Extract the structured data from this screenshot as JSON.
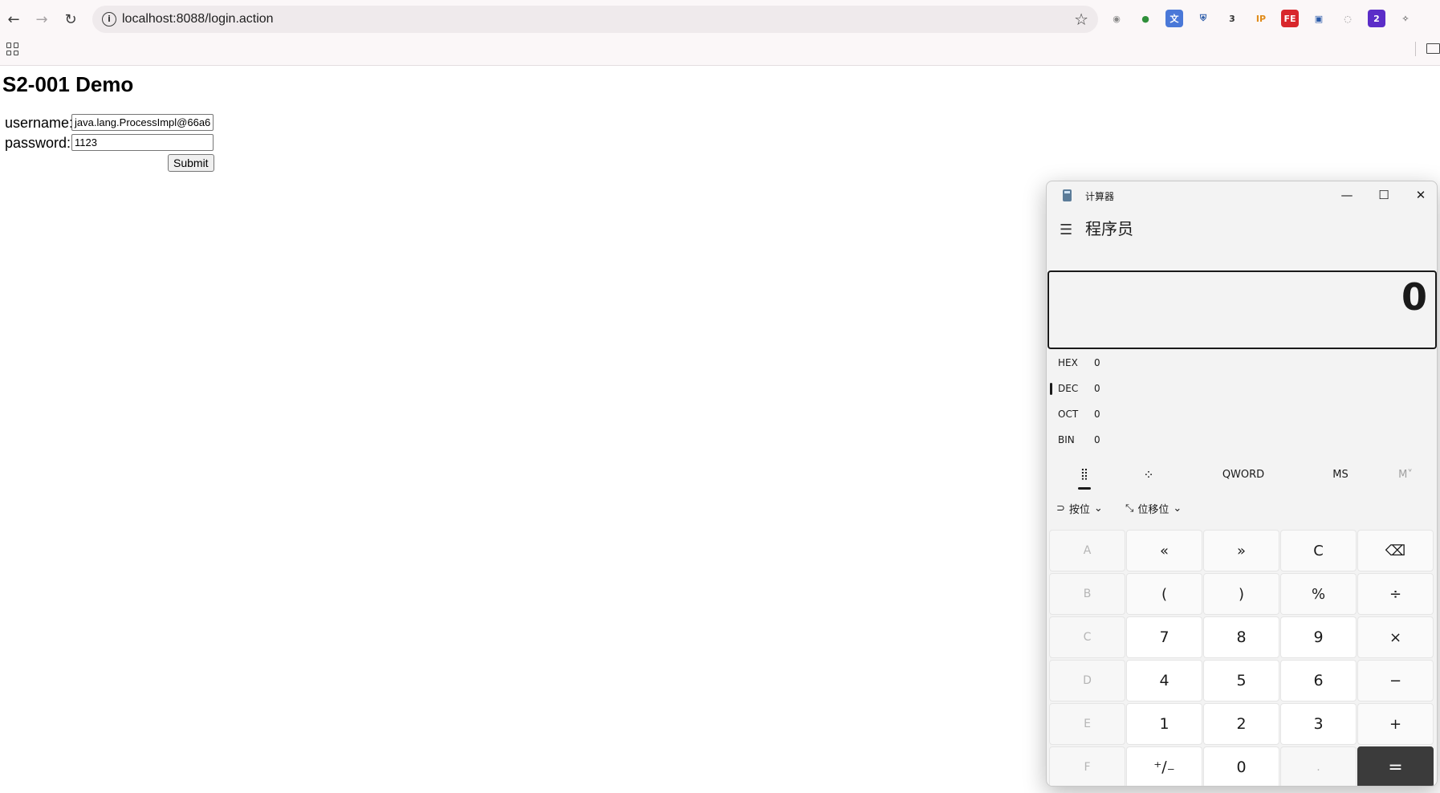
{
  "browser": {
    "url": "localhost:8088/login.action",
    "nav": {
      "back": "←",
      "forward": "→",
      "reload": "↻"
    },
    "star": "☆",
    "extensions": [
      {
        "name": "record-icon",
        "glyph": "◉",
        "color": "#888888",
        "bg": "transparent"
      },
      {
        "name": "globe-green-icon",
        "glyph": "●",
        "color": "#2f8f3a",
        "bg": "transparent"
      },
      {
        "name": "translate-icon",
        "glyph": "文",
        "color": "#ffffff",
        "bg": "#4a78d8"
      },
      {
        "name": "shield-icon",
        "glyph": "⛨",
        "color": "#2a5aa8",
        "bg": "transparent"
      },
      {
        "name": "puzzle-3-icon",
        "glyph": "3",
        "color": "#333333",
        "bg": "transparent"
      },
      {
        "name": "ip-icon",
        "glyph": "IP",
        "color": "#e08a18",
        "bg": "transparent"
      },
      {
        "name": "fe-icon",
        "glyph": "FE",
        "color": "#ffffff",
        "bg": "#d8272c"
      },
      {
        "name": "save-icon",
        "glyph": "▣",
        "color": "#2a5aa8",
        "bg": "transparent"
      },
      {
        "name": "chat-icon",
        "glyph": "◌",
        "color": "#888888",
        "bg": "transparent"
      },
      {
        "name": "profile-badge-icon",
        "glyph": "2",
        "color": "#ffffff",
        "bg": "#5b2dc8"
      },
      {
        "name": "extensions-icon",
        "glyph": "✧",
        "color": "#333333",
        "bg": "transparent"
      }
    ]
  },
  "page": {
    "title": "S2-001 Demo",
    "username_label": "username:",
    "username_value": "java.lang.ProcessImpl@66a6",
    "password_label": "password:",
    "password_value": "1123",
    "submit_label": "Submit"
  },
  "calculator": {
    "window_title": "计算器",
    "minimize": "—",
    "maximize": "☐",
    "close": "✕",
    "mode_title": "程序员",
    "display_value": "0",
    "radix": [
      {
        "label": "HEX",
        "value": "0"
      },
      {
        "label": "DEC",
        "value": "0"
      },
      {
        "label": "OCT",
        "value": "0"
      },
      {
        "label": "BIN",
        "value": "0"
      }
    ],
    "tabs": {
      "keypad_icon": "⣿",
      "bits_icon": "⁘",
      "word_size": "QWORD",
      "ms": "MS",
      "m_dropdown": "M˅"
    },
    "bitwise": {
      "label": "按位",
      "shift_label": "位移位"
    },
    "keys": [
      [
        "A",
        "«",
        "»",
        "C",
        "⌫"
      ],
      [
        "B",
        "(",
        ")",
        "%",
        "÷"
      ],
      [
        "C",
        "7",
        "8",
        "9",
        "×"
      ],
      [
        "D",
        "4",
        "5",
        "6",
        "−"
      ],
      [
        "E",
        "1",
        "2",
        "3",
        "+"
      ],
      [
        "F",
        "⁺∕₋",
        "0",
        ".",
        "="
      ]
    ]
  }
}
